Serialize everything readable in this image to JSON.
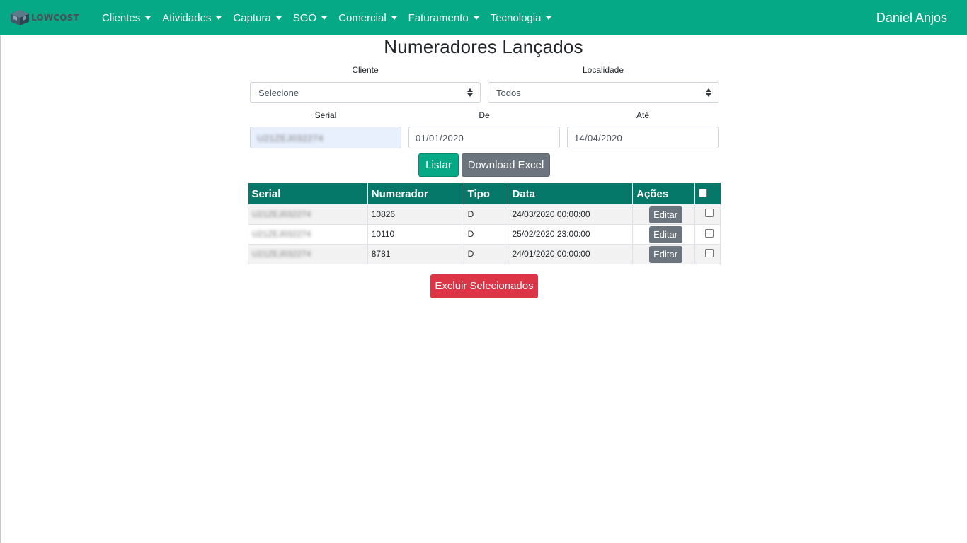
{
  "navbar": {
    "logo_text": "LOWCOST",
    "menu": [
      {
        "label": "Clientes"
      },
      {
        "label": "Atividades"
      },
      {
        "label": "Captura"
      },
      {
        "label": "SGO"
      },
      {
        "label": "Comercial"
      },
      {
        "label": "Faturamento"
      },
      {
        "label": "Tecnologia"
      }
    ],
    "user": "Daniel Anjos",
    "bg_color": "#05a986"
  },
  "page": {
    "title": "Numeradores Lançados"
  },
  "filters": {
    "cliente": {
      "label": "Cliente",
      "value": "Selecione"
    },
    "localidade": {
      "label": "Localidade",
      "value": "Todos"
    },
    "serial": {
      "label": "Serial",
      "value": "U21ZEJ032274"
    },
    "de": {
      "label": "De",
      "value": "01/01/2020"
    },
    "ate": {
      "label": "Até",
      "value": "14/04/2020"
    }
  },
  "buttons": {
    "listar": "Listar",
    "download_excel": "Download Excel",
    "excluir": "Excluir Selecionados",
    "listar_color": "#05a986",
    "excel_color": "#6c757d",
    "excluir_color": "#dc3545"
  },
  "table": {
    "headers": [
      "Serial",
      "Numerador",
      "Tipo",
      "Data",
      "Ações"
    ],
    "header_color": "#05786a",
    "edit_label": "Editar",
    "rows": [
      {
        "serial": "U21ZEJ032274",
        "numerador": "10826",
        "tipo": "D",
        "data": "24/03/2020 00:00:00"
      },
      {
        "serial": "U21ZEJ032274",
        "numerador": "10110",
        "tipo": "D",
        "data": "25/02/2020 23:00:00"
      },
      {
        "serial": "U21ZEJ032274",
        "numerador": "8781",
        "tipo": "D",
        "data": "24/01/2020 00:00:00"
      }
    ]
  }
}
